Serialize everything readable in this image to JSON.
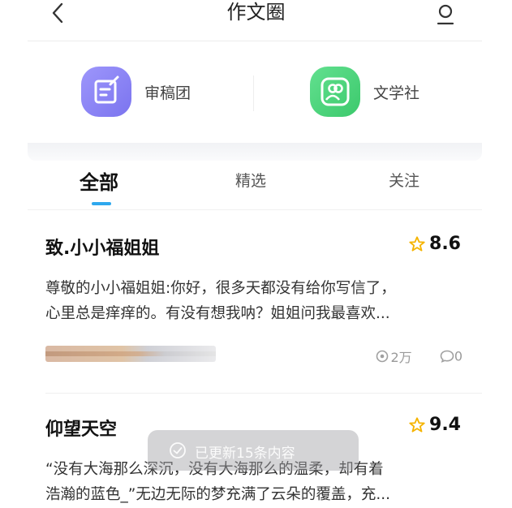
{
  "header": {
    "title": "作文圈",
    "back_icon": "chevron-left-icon",
    "user_icon": "user-icon"
  },
  "features": [
    {
      "label": "审稿团",
      "icon": "edit-square-icon",
      "color": "#8b83f5"
    },
    {
      "label": "文学社",
      "icon": "people-icon",
      "color": "#4bd37b"
    }
  ],
  "tabs": [
    {
      "label": "全部",
      "active": true
    },
    {
      "label": "精选",
      "active": false
    },
    {
      "label": "关注",
      "active": false
    }
  ],
  "accent": "#2ea8ee",
  "articles": [
    {
      "title": "致.小小福姐姐",
      "score": "8.6",
      "excerpt_line1": "尊敬的小小福姐姐:你好，很多天都没有给你写信了，",
      "excerpt_line2": "心里总是痒痒的。有没有想我呐？姐姐问我最喜欢...",
      "views": "2万",
      "comments": "0"
    },
    {
      "title": "仰望天空",
      "score": "9.4",
      "excerpt_line1": "“没有大海那么深沉，没有大海那么的温柔，却有着",
      "excerpt_line2": "浩瀚的蓝色_”无边无际的梦充满了云朵的覆盖，充..."
    }
  ],
  "toast": {
    "text": "已更新15条内容"
  }
}
